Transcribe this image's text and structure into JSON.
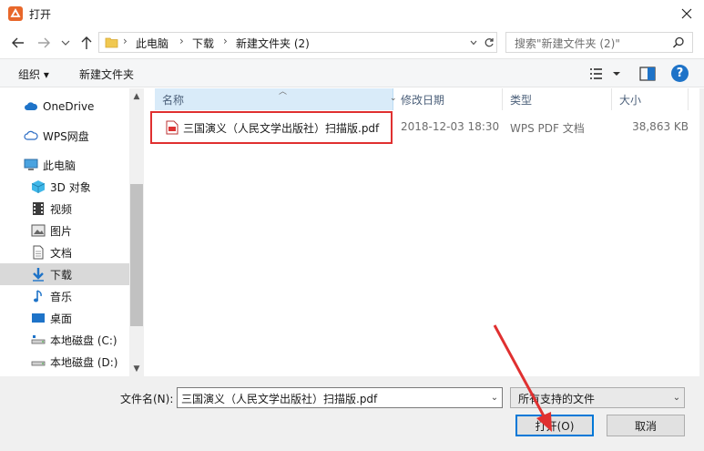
{
  "window": {
    "title": "打开"
  },
  "address": {
    "crumbs": [
      "此电脑",
      "下载",
      "新建文件夹 (2)"
    ],
    "separator": "›"
  },
  "search": {
    "placeholder": "搜索\"新建文件夹 (2)\""
  },
  "toolbar": {
    "organize": "组织 ▾",
    "new_folder": "新建文件夹",
    "help": "?"
  },
  "sidebar": {
    "items": [
      {
        "label": "OneDrive",
        "icon": "cloud-icon"
      },
      {
        "label": "WPS网盘",
        "icon": "cloud-outline-icon"
      },
      {
        "label": "此电脑",
        "icon": "computer-icon"
      },
      {
        "label": "3D 对象",
        "icon": "cube-icon"
      },
      {
        "label": "视频",
        "icon": "video-icon"
      },
      {
        "label": "图片",
        "icon": "picture-icon"
      },
      {
        "label": "文档",
        "icon": "document-icon"
      },
      {
        "label": "下载",
        "icon": "download-icon",
        "selected": true
      },
      {
        "label": "音乐",
        "icon": "music-icon"
      },
      {
        "label": "桌面",
        "icon": "desktop-icon"
      },
      {
        "label": "本地磁盘 (C:)",
        "icon": "drive-icon"
      },
      {
        "label": "本地磁盘 (D:)",
        "icon": "drive-icon"
      }
    ]
  },
  "columns": {
    "name": "名称",
    "date": "修改日期",
    "type": "类型",
    "size": "大小"
  },
  "files": [
    {
      "name": "三国演义（人民文学出版社）扫描版.pdf",
      "date": "2018-12-03 18:30",
      "type": "WPS PDF 文档",
      "size": "38,863 KB"
    }
  ],
  "bottom": {
    "filename_label": "文件名(N):",
    "filename_value": "三国演义（人民文学出版社）扫描版.pdf",
    "filter_value": "所有支持的文件",
    "open_label": "打开(O)",
    "cancel_label": "取消"
  },
  "colors": {
    "accent": "#0078d7",
    "highlight": "#e03030",
    "arrow": "#e03030"
  }
}
